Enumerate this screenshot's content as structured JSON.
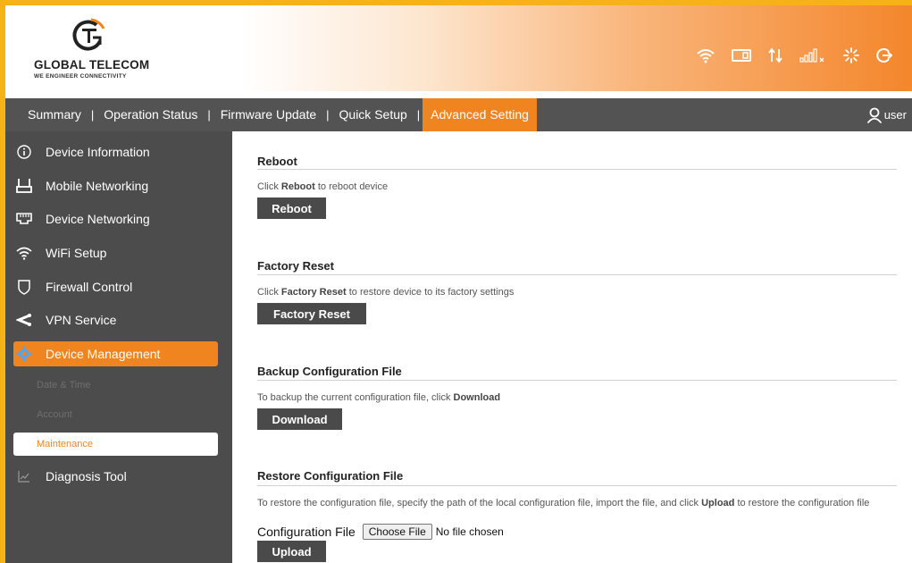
{
  "header": {
    "brand_name": "GLOBAL TELECOM",
    "brand_tagline": "WE ENGINEER CONNECTIVITY",
    "status_icons": [
      "wifi-icon",
      "sim-card-icon",
      "data-transfer-icon",
      "signal-strength-icon",
      "loading-icon",
      "logout-icon"
    ]
  },
  "nav": {
    "items": [
      {
        "label": "Summary"
      },
      {
        "label": "Operation Status"
      },
      {
        "label": "Firmware Update"
      },
      {
        "label": "Quick Setup"
      },
      {
        "label": "Advanced Setting",
        "active": true
      }
    ],
    "separator": "|",
    "user_label": "user"
  },
  "sidebar": {
    "items": [
      {
        "label": "Device Information",
        "icon": "info-icon"
      },
      {
        "label": "Mobile Networking",
        "icon": "router-icon"
      },
      {
        "label": "Device Networking",
        "icon": "ethernet-port-icon"
      },
      {
        "label": "WiFi Setup",
        "icon": "wifi-icon"
      },
      {
        "label": "Firewall Control",
        "icon": "shield-icon"
      },
      {
        "label": "VPN Service",
        "icon": "vpn-icon"
      },
      {
        "label": "Device Management",
        "icon": "gear-icon",
        "active": true
      },
      {
        "label": "Diagnosis Tool",
        "icon": "chart-icon"
      }
    ],
    "subitems": [
      {
        "label": "Date & Time"
      },
      {
        "label": "Account"
      },
      {
        "label": "Maintenance",
        "active": true
      }
    ]
  },
  "content": {
    "reboot": {
      "title": "Reboot",
      "desc_prefix": "Click ",
      "desc_bold": "Reboot",
      "desc_suffix": " to reboot device",
      "button": "Reboot"
    },
    "factory_reset": {
      "title": "Factory Reset",
      "desc_prefix": "Click ",
      "desc_bold": "Factory Reset",
      "desc_suffix": " to restore device to its factory settings",
      "button": "Factory Reset"
    },
    "backup": {
      "title": "Backup Configuration File",
      "desc_prefix": "To backup the current configuration file, click ",
      "desc_bold": "Download",
      "desc_suffix": "",
      "button": "Download"
    },
    "restore": {
      "title": "Restore Configuration File",
      "desc_prefix": "To restore the configuration file, specify the path of the local configuration file, import the file, and click ",
      "desc_bold": "Upload",
      "desc_suffix": " to restore the configuration file",
      "file_label": "Configuration File",
      "file_button": "Choose File",
      "file_status": "No file chosen",
      "button": "Upload"
    }
  },
  "colors": {
    "accent": "#f0841f",
    "frame": "#f7b21a",
    "nav_bg": "#535353",
    "sidebar_bg": "#4c4c4c",
    "button_bg": "#4a4a4a"
  }
}
